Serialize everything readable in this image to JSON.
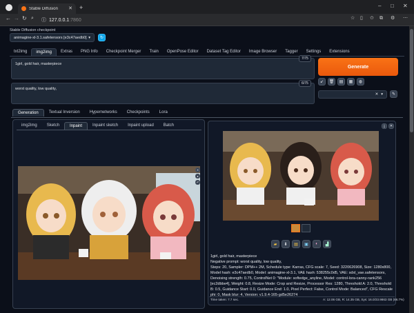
{
  "browser": {
    "tab_title": "Stable Diffusion",
    "url_host": "127.0.0.1",
    "url_port": ":7860"
  },
  "checkpoint": {
    "label": "Stable Diffusion checkpoint",
    "value": "animagine-xl-3.1.safetensors [e3c47aedb0]"
  },
  "main_tabs": [
    "txt2img",
    "img2img",
    "Extras",
    "PNG Info",
    "Checkpoint Merger",
    "Train",
    "OpenPose Editor",
    "Dataset Tag Editor",
    "Image Browser",
    "Tagger",
    "Settings",
    "Extensions"
  ],
  "prompt": {
    "positive": "1girl, gold hair, masterpiece",
    "positive_count": "7/75",
    "negative": "worst quality, low quality,",
    "negative_count": "6/75"
  },
  "generate_label": "Generate",
  "sub_tabs": [
    "Generation",
    "Textual Inversion",
    "Hypernetworks",
    "Checkpoints",
    "Lora"
  ],
  "img2img_tabs": [
    "img2img",
    "Sketch",
    "Inpaint",
    "Inpaint sketch",
    "Inpaint upload",
    "Batch"
  ],
  "output_info": {
    "prompt": "1girl, gold hair, masterpiece",
    "negative": "Negative prompt: worst quality, low quality,",
    "params": "Steps: 20, Sampler: DPM++ 2M, Schedule type: Karras, CFG scale: 7, Seed: 3220626908, Size: 1280x800, Model hash: e3c47aedb0, Model: animagine-xl-3.1, VAE hash: 538255c0d5, VAE: sdxl_vae.safetensors, Denoising strength: 0.75, ControlNet 0: \"Module: softedge_anyline, Model: control-lora-canny-rank256 [ec2dbbe4], Weight: 0.8, Resize Mode: Crop and Resize, Processor Res: 1280, Threshold A: 2.0, Threshold B: 0.5, Guidance Start: 0.0, Guidance End: 1.0, Pixel Perfect: False, Control Mode: Balanced\", CFG Rescale phi: 0, Mask blur: 4, Version: v1.9.4-165-gd5e26274",
    "time": "Time taken: 7.7 sec.",
    "vram": "A: 12.06 GB, R: 14.35 GB, Sys: 16.0/23.9863 GB (66.7%)"
  },
  "icons": [
    "arrow-left-icon",
    "arrow-right-icon",
    "refresh-icon",
    "home-icon",
    "info-icon",
    "star-icon",
    "extensions-icon",
    "profile-icon",
    "minimize-icon",
    "maximize-icon",
    "close-icon",
    "folder-icon",
    "save-icon",
    "zip-icon",
    "image-icon",
    "palette-icon",
    "chart-icon",
    "trash-icon",
    "paste-icon",
    "clipboard-icon",
    "apply-icon",
    "brush-icon"
  ],
  "accent": "#ea580c"
}
